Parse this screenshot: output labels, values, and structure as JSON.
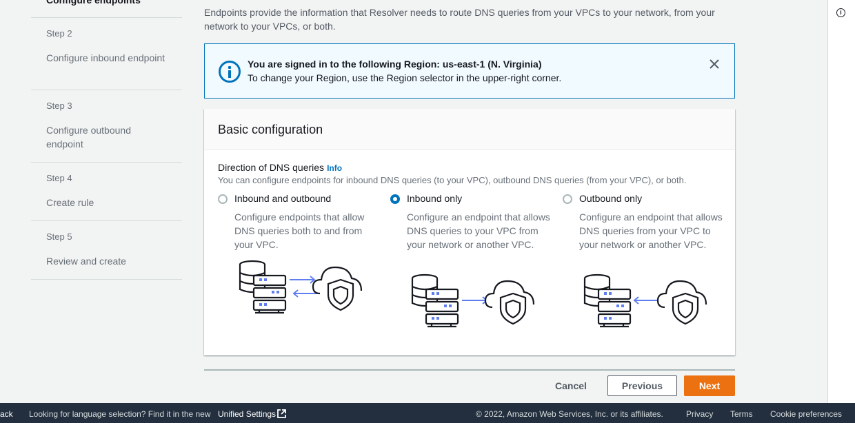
{
  "steps": {
    "current_label": "Configure endpoints",
    "items": [
      {
        "num": "Step 2",
        "label": "Configure inbound endpoint"
      },
      {
        "num": "Step 3",
        "label": "Configure outbound endpoint"
      },
      {
        "num": "Step 4",
        "label": "Create rule"
      },
      {
        "num": "Step 5",
        "label": "Review and create"
      }
    ]
  },
  "intro_text": "Endpoints provide the information that Resolver needs to route DNS queries from your VPCs to your network, from your network to your VPCs, or both.",
  "alert": {
    "title": "You are signed in to the following Region: us-east-1 (N. Virginia)",
    "text": "To change your Region, use the Region selector in the upper-right corner."
  },
  "basic_config": {
    "title": "Basic configuration",
    "field_label": "Direction of DNS queries",
    "info_link": "Info",
    "field_desc": "You can configure endpoints for inbound DNS queries (to your VPC), outbound DNS queries (from your VPC), or both.",
    "options": [
      {
        "title": "Inbound and outbound",
        "desc": "Configure endpoints that allow DNS queries both to and from your VPC.",
        "checked": false
      },
      {
        "title": "Inbound only",
        "desc": "Configure an endpoint that allows DNS queries to your VPC from your network or another VPC.",
        "checked": true
      },
      {
        "title": "Outbound only",
        "desc": "Configure an endpoint that allows DNS queries from your VPC to your network or another VPC.",
        "checked": false
      }
    ]
  },
  "actions": {
    "cancel": "Cancel",
    "previous": "Previous",
    "next": "Next"
  },
  "footer": {
    "back": "ack",
    "language_prompt": "Looking for language selection? Find it in the new",
    "unified_settings": "Unified Settings",
    "copyright": "© 2022, Amazon Web Services, Inc. or its affiliates.",
    "privacy": "Privacy",
    "terms": "Terms",
    "cookies": "Cookie preferences"
  },
  "colors": {
    "accent": "#0073bb",
    "primary_button": "#ec7211",
    "footer_bg": "#232f3e",
    "illustration_arrow": "#5f7ff0"
  }
}
